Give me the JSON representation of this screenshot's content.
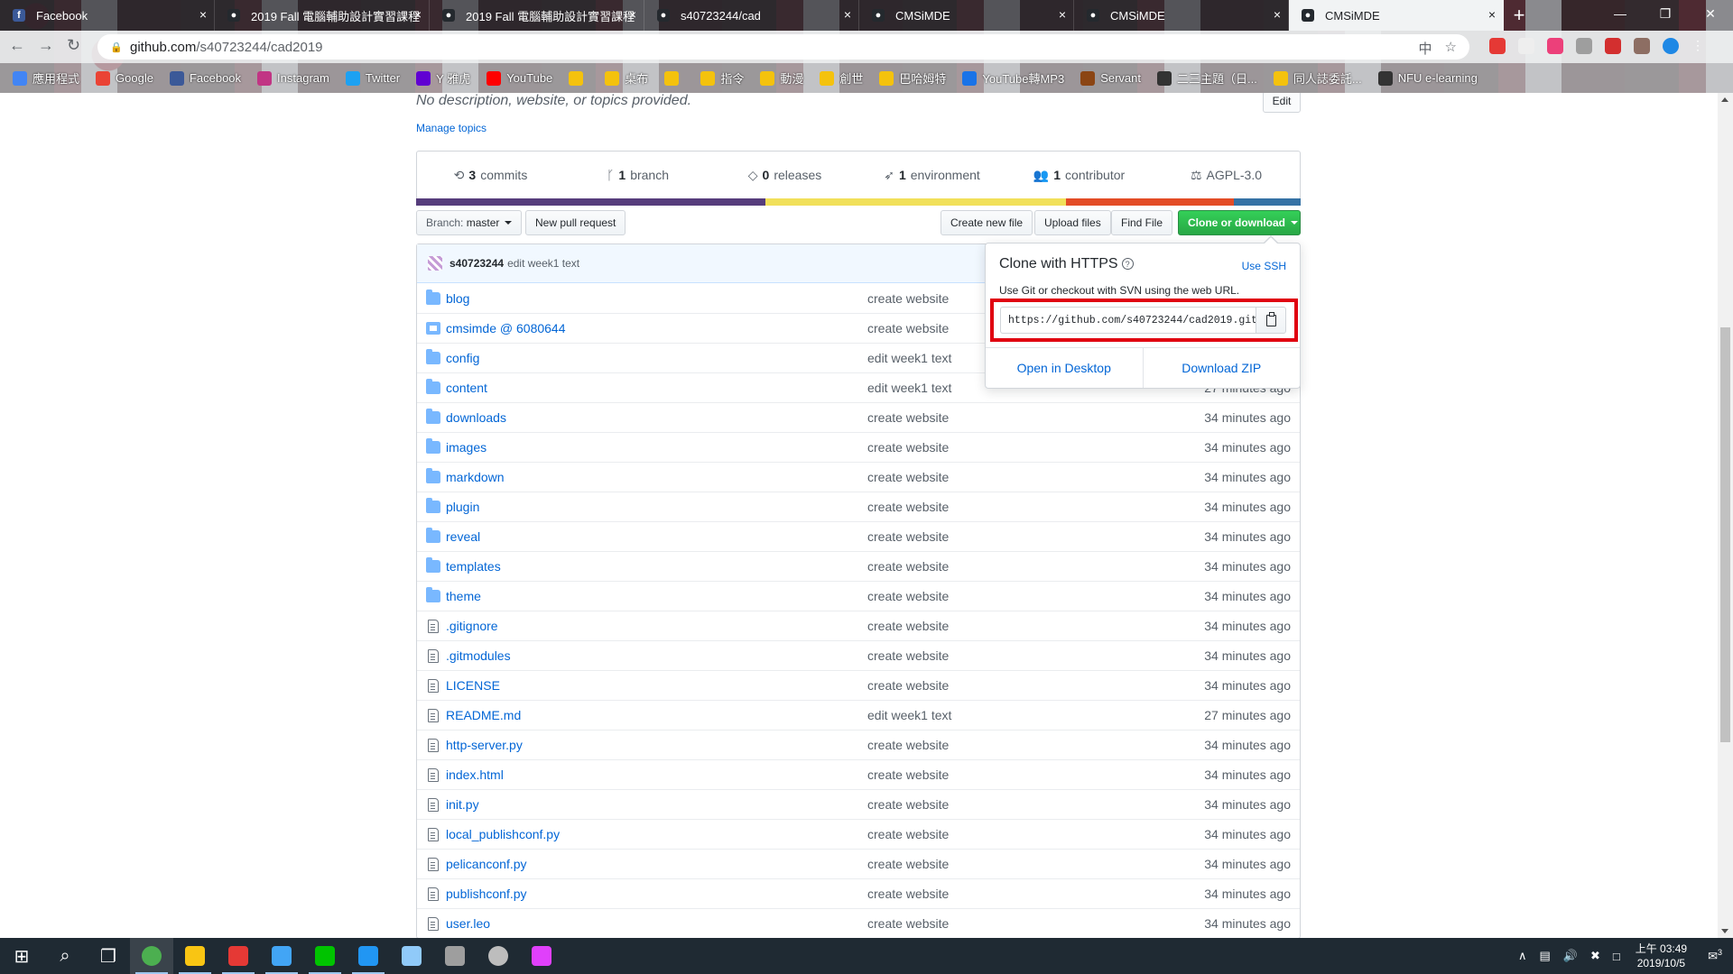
{
  "browser": {
    "tabs": [
      {
        "title": "Facebook",
        "icon": "facebook-icon",
        "color": "#3b5998",
        "active": false
      },
      {
        "title": "2019 Fall 電腦輔助設計實習課程",
        "icon": "github-icon",
        "color": "#24292e",
        "active": false
      },
      {
        "title": "2019 Fall 電腦輔助設計實習課程",
        "icon": "github-icon",
        "color": "#24292e",
        "active": false
      },
      {
        "title": "s40723244/cad",
        "icon": "github-icon",
        "color": "#24292e",
        "active": false
      },
      {
        "title": "CMSiMDE",
        "icon": "github-icon",
        "color": "#24292e",
        "active": false
      },
      {
        "title": "CMSiMDE",
        "icon": "github-icon",
        "color": "#24292e",
        "active": false
      },
      {
        "title": "CMSiMDE",
        "icon": "github-icon",
        "color": "#24292e",
        "active": true
      }
    ],
    "url_host": "github.com",
    "url_path": "/s40723244/cad2019",
    "bookmarks": [
      {
        "label": "應用程式",
        "color": "#4285f4"
      },
      {
        "label": "Google",
        "color": "#ea4335"
      },
      {
        "label": "Facebook",
        "color": "#3b5998"
      },
      {
        "label": "Instagram",
        "color": "#c13584"
      },
      {
        "label": "Twitter",
        "color": "#1da1f2"
      },
      {
        "label": "Y 雅虎",
        "color": "#6001d2"
      },
      {
        "label": "YouTube",
        "color": "#ff0000"
      },
      {
        "label": "  ",
        "color": "#f4c20d"
      },
      {
        "label": "桌布",
        "color": "#f4c20d"
      },
      {
        "label": "  ",
        "color": "#f4c20d"
      },
      {
        "label": "指令",
        "color": "#f4c20d"
      },
      {
        "label": "動漫",
        "color": "#f4c20d"
      },
      {
        "label": "創世",
        "color": "#f4c20d"
      },
      {
        "label": "巴哈姆特",
        "color": "#f4c20d"
      },
      {
        "label": "YouTube轉MP3",
        "color": "#1a73e8"
      },
      {
        "label": "Servant",
        "color": "#8b4513"
      },
      {
        "label": "二三主題（日...",
        "color": "#333333"
      },
      {
        "label": "同人誌委託...",
        "color": "#f4c20d"
      },
      {
        "label": "NFU e-learning",
        "color": "#333333"
      }
    ]
  },
  "repo": {
    "description": "No description, website, or topics provided.",
    "edit_label": "Edit",
    "manage_topics": "Manage topics",
    "numbers": [
      {
        "icon": "history-icon",
        "count": "3",
        "label": "commits"
      },
      {
        "icon": "branch-icon",
        "count": "1",
        "label": "branch"
      },
      {
        "icon": "tag-icon",
        "count": "0",
        "label": "releases"
      },
      {
        "icon": "rocket-icon",
        "count": "1",
        "label": "environment"
      },
      {
        "icon": "people-icon",
        "count": "1",
        "label": "contributor"
      },
      {
        "icon": "law-icon",
        "count": "",
        "label": "AGPL-3.0"
      }
    ],
    "languages": [
      {
        "color": "#563d7c",
        "share": 0.395
      },
      {
        "color": "#f1e05a",
        "share": 0.34
      },
      {
        "color": "#e34c26",
        "share": 0.19
      },
      {
        "color": "#3572a5",
        "share": 0.075
      }
    ],
    "actions": {
      "branch_prefix": "Branch:",
      "branch": "master",
      "new_pull_request": "New pull request",
      "create_new_file": "Create new file",
      "upload_files": "Upload files",
      "find_file": "Find File",
      "clone_or_download": "Clone or download"
    },
    "latest_commit": {
      "author": "s40723244",
      "message": "edit week1 text"
    },
    "files": [
      {
        "type": "dir",
        "name": "blog",
        "message": "create website",
        "age": ""
      },
      {
        "type": "submodule",
        "name": "cmsimde @ 6080644",
        "message": "create website",
        "age": ""
      },
      {
        "type": "dir",
        "name": "config",
        "message": "edit week1 text",
        "age": ""
      },
      {
        "type": "dir",
        "name": "content",
        "message": "edit week1 text",
        "age": "27 minutes ago"
      },
      {
        "type": "dir",
        "name": "downloads",
        "message": "create website",
        "age": "34 minutes ago"
      },
      {
        "type": "dir",
        "name": "images",
        "message": "create website",
        "age": "34 minutes ago"
      },
      {
        "type": "dir",
        "name": "markdown",
        "message": "create website",
        "age": "34 minutes ago"
      },
      {
        "type": "dir",
        "name": "plugin",
        "message": "create website",
        "age": "34 minutes ago"
      },
      {
        "type": "dir",
        "name": "reveal",
        "message": "create website",
        "age": "34 minutes ago"
      },
      {
        "type": "dir",
        "name": "templates",
        "message": "create website",
        "age": "34 minutes ago"
      },
      {
        "type": "dir",
        "name": "theme",
        "message": "create website",
        "age": "34 minutes ago"
      },
      {
        "type": "file",
        "name": ".gitignore",
        "message": "create website",
        "age": "34 minutes ago"
      },
      {
        "type": "file",
        "name": ".gitmodules",
        "message": "create website",
        "age": "34 minutes ago"
      },
      {
        "type": "file",
        "name": "LICENSE",
        "message": "create website",
        "age": "34 minutes ago"
      },
      {
        "type": "file",
        "name": "README.md",
        "message": "edit week1 text",
        "age": "27 minutes ago"
      },
      {
        "type": "file",
        "name": "http-server.py",
        "message": "create website",
        "age": "34 minutes ago"
      },
      {
        "type": "file",
        "name": "index.html",
        "message": "create website",
        "age": "34 minutes ago"
      },
      {
        "type": "file",
        "name": "init.py",
        "message": "create website",
        "age": "34 minutes ago"
      },
      {
        "type": "file",
        "name": "local_publishconf.py",
        "message": "create website",
        "age": "34 minutes ago"
      },
      {
        "type": "file",
        "name": "pelicanconf.py",
        "message": "create website",
        "age": "34 minutes ago"
      },
      {
        "type": "file",
        "name": "publishconf.py",
        "message": "create website",
        "age": "34 minutes ago"
      },
      {
        "type": "file",
        "name": "user.leo",
        "message": "create website",
        "age": "34 minutes ago"
      }
    ]
  },
  "clone_popup": {
    "title": "Clone with HTTPS",
    "use_ssh": "Use SSH",
    "subtitle": "Use Git or checkout with SVN using the web URL.",
    "url": "https://github.com/s40723244/cad2019.git",
    "open_desktop": "Open in Desktop",
    "download_zip": "Download ZIP"
  },
  "taskbar": {
    "apps": [
      {
        "icon": "windows-start-icon",
        "color": "#ffffff"
      },
      {
        "icon": "search-icon",
        "color": "#ffffff"
      },
      {
        "icon": "task-view-icon",
        "color": "#ffffff"
      },
      {
        "icon": "chrome-icon",
        "color": "#4caf50"
      },
      {
        "icon": "file-explorer-icon",
        "color": "#f9c513"
      },
      {
        "icon": "garena-icon",
        "color": "#e53935"
      },
      {
        "icon": "blue-app-icon",
        "color": "#42a5f5"
      },
      {
        "icon": "line-icon",
        "color": "#00c300"
      },
      {
        "icon": "messenger-icon",
        "color": "#2196f3"
      },
      {
        "icon": "notepad-icon",
        "color": "#90caf9"
      },
      {
        "icon": "terminal-icon",
        "color": "#9e9e9e"
      },
      {
        "icon": "leo-icon",
        "color": "#bdbdbd"
      },
      {
        "icon": "paint-icon",
        "color": "#e040fb"
      }
    ],
    "time": "上午 03:49",
    "date": "2019/10/5",
    "notification_count": "3"
  }
}
